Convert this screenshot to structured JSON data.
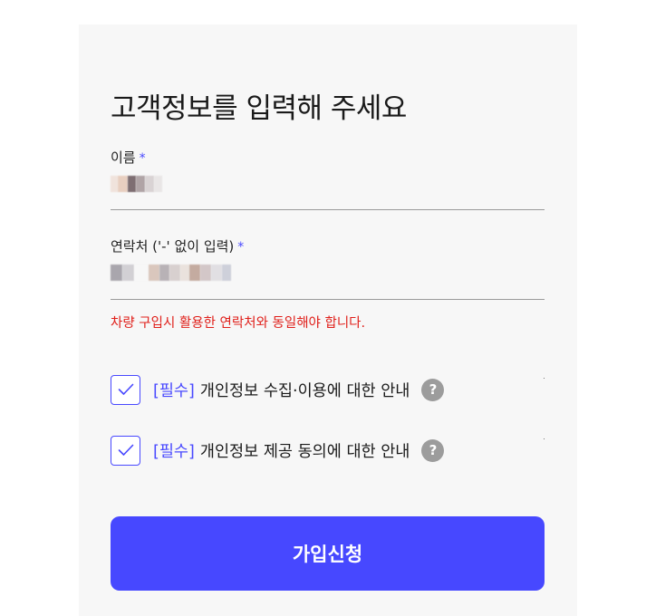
{
  "form": {
    "title": "고객정보를 입력해 주세요",
    "required_mark": "*",
    "name_field": {
      "label": "이름"
    },
    "phone_field": {
      "label": "연락처 ('-' 없이 입력)"
    },
    "error_message": "차량 구입시 활용한 연락처와 동일해야 합니다.",
    "agreements": [
      {
        "tag": "[필수]",
        "label": "개인정보 수집·이용에 대한 안내",
        "checked": true,
        "help": "?"
      },
      {
        "tag": "[필수]",
        "label": "개인정보 제공 동의에 대한 안내",
        "checked": true,
        "help": "?"
      }
    ],
    "submit_label": "가입신청"
  },
  "colors": {
    "accent": "#4748ff",
    "error": "#e0201b",
    "panel_background": "#f7f7f7",
    "help_icon": "#9c9c9c"
  }
}
